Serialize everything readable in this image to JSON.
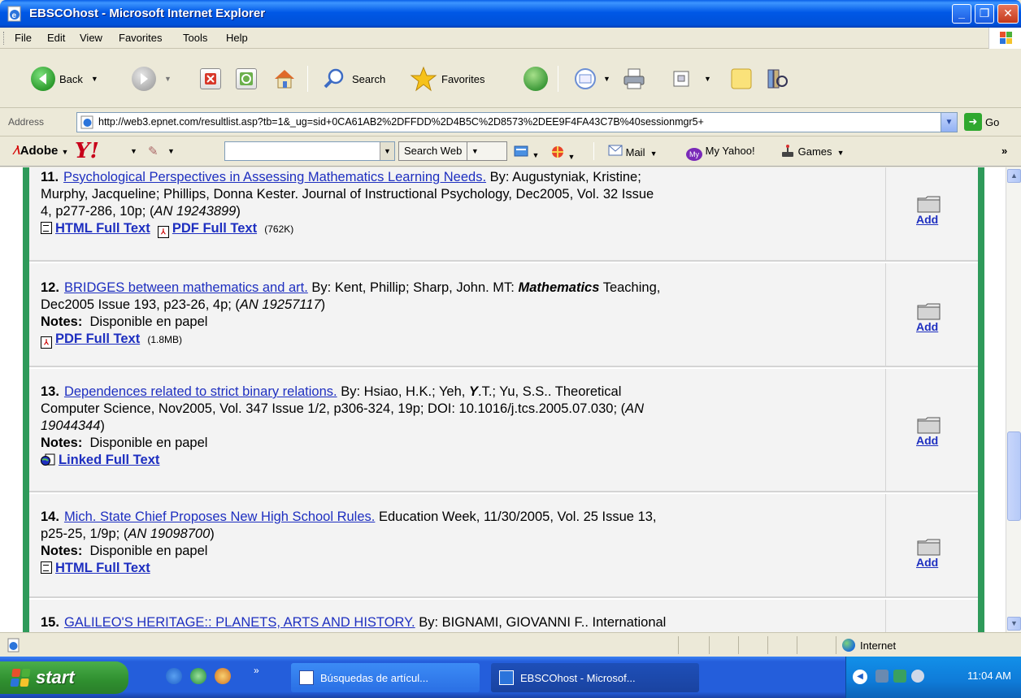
{
  "window": {
    "title": "EBSCOhost - Microsoft Internet Explorer"
  },
  "menu": [
    "File",
    "Edit",
    "View",
    "Favorites",
    "Tools",
    "Help"
  ],
  "toolbar": {
    "back": "Back",
    "search": "Search",
    "favorites": "Favorites"
  },
  "address": {
    "label": "Address",
    "url": "http://web3.epnet.com/resultlist.asp?tb=1&_ug=sid+0CA61AB2%2DFFDD%2D4B5C%2D8573%2DEE9F4FA43C7B%40sessionmgr5+",
    "go": "Go"
  },
  "yahoo_toolbar": {
    "adobe": "Adobe",
    "search_value": "",
    "search_web": "Search Web",
    "mail": "Mail",
    "my_yahoo": "My Yahoo!",
    "games": "Games"
  },
  "results": [
    {
      "num": "11.",
      "title": "Psychological Perspectives in Assessing Mathematics Learning Needs.",
      "line1_rest": " By: Augustyniak, Kristine;",
      "line2": "Murphy, Jacqueline; Phillips, Donna Kester. Journal of Instructional Psychology, Dec2005, Vol. 32 Issue",
      "line3": "4, p277-286, 10p; (",
      "an": "AN 19243899",
      "html_link": "HTML Full Text",
      "pdf_link": "PDF Full Text",
      "pdf_size": "(762K)",
      "add": "Add"
    },
    {
      "num": "12.",
      "title": "BRIDGES between mathematics and art.",
      "line1_rest": " By: Kent, Phillip; Sharp, John. MT: ",
      "line1_bold": "Mathematics",
      "line1_tail": " Teaching,",
      "line2": "Dec2005 Issue 193, p23-26, 4p; (",
      "an": "AN 19257117",
      "notes_label": "Notes:",
      "notes": "Disponible en papel",
      "pdf_link": "PDF Full Text",
      "pdf_size": "(1.8MB)",
      "add": "Add"
    },
    {
      "num": "13.",
      "title": "Dependences related to strict binary relations.",
      "line1_rest": " By: Hsiao, H.K.; Yeh, ",
      "line1_bold": "Y",
      "line1_tail": ".T.; Yu, S.S.. Theoretical",
      "line2": "Computer Science, Nov2005, Vol. 347 Issue 1/2, p306-324, 19p; DOI: 10.1016/j.tcs.2005.07.030; (",
      "an_part1": "AN",
      "an_part2": "19044344",
      "notes_label": "Notes:",
      "notes": "Disponible en papel",
      "linked_link": "Linked Full Text",
      "add": "Add"
    },
    {
      "num": "14.",
      "title": "Mich. State Chief Proposes New High School Rules.",
      "line1_rest": " Education Week, 11/30/2005, Vol. 25 Issue 13,",
      "line2": "p25-25, 1/9p; (",
      "an": "AN 19098700",
      "notes_label": "Notes:",
      "notes": "Disponible en papel",
      "html_link": "HTML Full Text",
      "add": "Add"
    },
    {
      "num": "15.",
      "title": "GALILEO'S HERITAGE:: PLANETS, ARTS AND HISTORY.",
      "line1_rest": " By: BIGNAMI, GIOVANNI F.. International"
    }
  ],
  "status": {
    "zone": "Internet"
  },
  "taskbar": {
    "start": "start",
    "tasks": [
      "Búsquedas de artícul...",
      "EBSCOhost - Microsof..."
    ],
    "clock": "11:04 AM"
  }
}
